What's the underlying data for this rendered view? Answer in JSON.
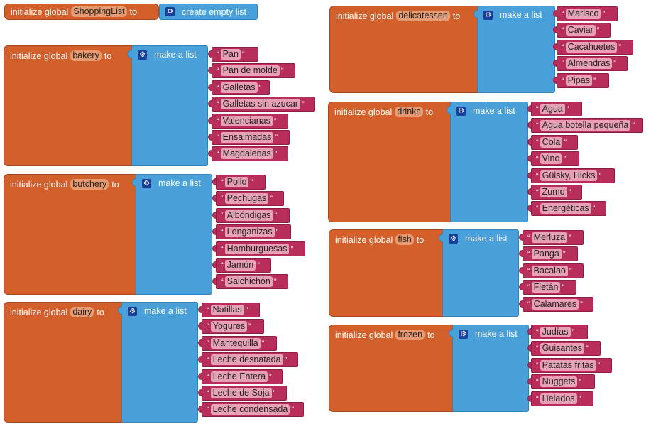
{
  "labels": {
    "initialize_global": "initialize global",
    "to": "to",
    "make_a_list": "make a list",
    "create_empty_list": "create empty list",
    "quote_open": "“",
    "quote_close": "”",
    "gear_glyph": "⚙"
  },
  "icons": {
    "settings": "gear-icon"
  },
  "colors": {
    "init_block": "#d35f2a",
    "list_block": "#4aa1d9",
    "text_block": "#b82d5a",
    "gear": "#1a3e9b"
  },
  "shopping_list": {
    "name": "ShoppingList"
  },
  "blocks": [
    {
      "key": "bakery",
      "name": "bakery",
      "items": [
        "Pan",
        "Pan de molde",
        "Galletas",
        "Galletas sin azucar",
        "Valencianas",
        "Ensaimadas",
        "Magdalenas"
      ]
    },
    {
      "key": "butchery",
      "name": "butchery",
      "items": [
        "Pollo",
        "Pechugas",
        "Albóndigas",
        "Longanizas",
        "Hamburguesas",
        "Jamón",
        "Salchichón"
      ]
    },
    {
      "key": "dairy",
      "name": "dairy",
      "items": [
        "Natillas",
        "Yogures",
        "Mantequilla",
        "Leche desnatada",
        "Leche Entera",
        "Leche de Soja",
        "Leche condensada"
      ]
    },
    {
      "key": "delicatessen",
      "name": "delicatessen",
      "items": [
        "Marisco",
        "Caviar",
        "Cacahuetes",
        "Almendras",
        "Pipas"
      ]
    },
    {
      "key": "drinks",
      "name": "drinks",
      "items": [
        "Agua",
        "Agua botella pequeña",
        "Cola",
        "Vino",
        "Güisky, Hicks",
        "Zumo",
        "Energéticas"
      ]
    },
    {
      "key": "fish",
      "name": "fish",
      "items": [
        "Merluza",
        "Panga",
        "Bacalao",
        "Fletán",
        "Calamares"
      ]
    },
    {
      "key": "frozen",
      "name": "frozen",
      "items": [
        "Judías",
        "Guisantes",
        "Patatas fritas",
        "Nuggets",
        "Helados"
      ]
    }
  ]
}
